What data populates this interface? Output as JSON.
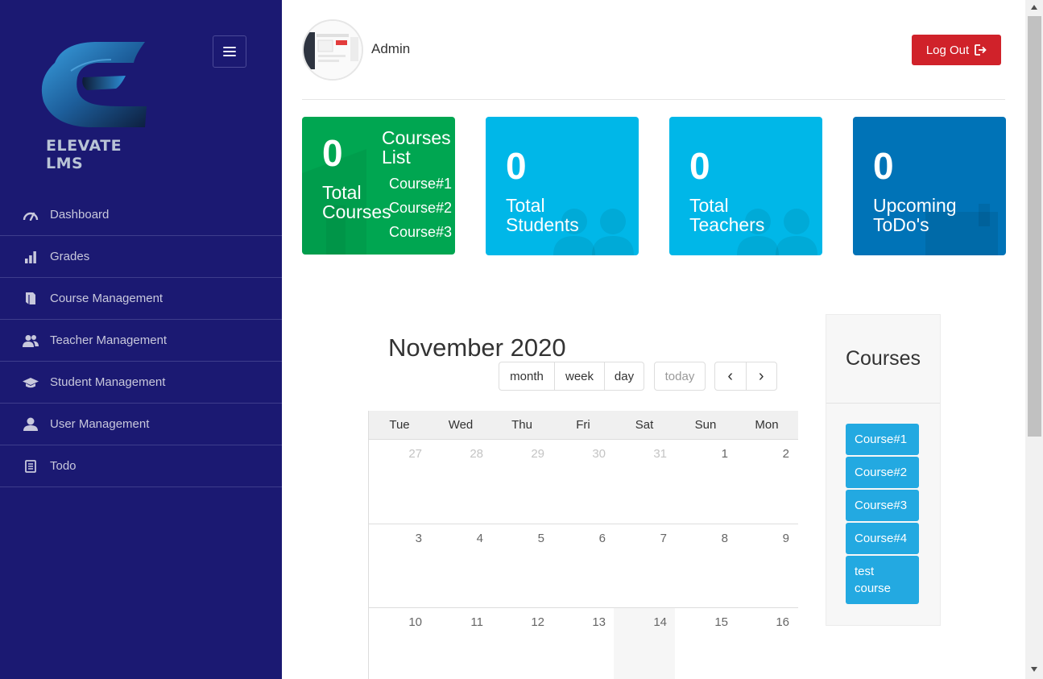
{
  "brand": {
    "name": "ELEVATE LMS"
  },
  "sidebar": {
    "items": [
      {
        "label": "Dashboard",
        "icon": "speedometer-icon"
      },
      {
        "label": "Grades",
        "icon": "bar-chart-icon"
      },
      {
        "label": "Course Management",
        "icon": "book-icon"
      },
      {
        "label": "Teacher Management",
        "icon": "users-icon"
      },
      {
        "label": "Student Management",
        "icon": "graduation-cap-icon"
      },
      {
        "label": "User Management",
        "icon": "user-icon"
      },
      {
        "label": "Todo",
        "icon": "document-list-icon"
      }
    ]
  },
  "header": {
    "user": "Admin",
    "logout_label": "Log Out"
  },
  "stats": {
    "courses": {
      "value": "0",
      "line1": "Total",
      "line2": "Courses",
      "list_title_1": "Courses",
      "list_title_2": "List",
      "list": [
        "Course#1",
        "Course#2",
        "Course#3"
      ]
    },
    "students": {
      "value": "0",
      "line1": "Total",
      "line2": "Students"
    },
    "teachers": {
      "value": "0",
      "line1": "Total",
      "line2": "Teachers"
    },
    "todos": {
      "value": "0",
      "line1": "Upcoming",
      "line2": "ToDo's"
    }
  },
  "colors": {
    "sidebar": "#1b1972",
    "green": "#00a651",
    "cyan": "#00b7e8",
    "blue": "#0073b7",
    "logout": "#d0222a",
    "chip": "#23a9e1"
  },
  "calendar": {
    "title": "November 2020",
    "views": {
      "month": "month",
      "week": "week",
      "day": "day"
    },
    "today_label": "today",
    "prev": "‹",
    "next": "›",
    "weekdays": [
      "Tue",
      "Wed",
      "Thu",
      "Fri",
      "Sat",
      "Sun",
      "Mon"
    ],
    "weeks": [
      [
        "27",
        "28",
        "29",
        "30",
        "31",
        "1",
        "2"
      ],
      [
        "3",
        "4",
        "5",
        "6",
        "7",
        "8",
        "9"
      ],
      [
        "10",
        "11",
        "12",
        "13",
        "14",
        "15",
        "16"
      ]
    ]
  },
  "courses_panel": {
    "title": "Courses",
    "items": [
      "Course#1",
      "Course#2",
      "Course#3",
      "Course#4",
      "test course"
    ]
  }
}
